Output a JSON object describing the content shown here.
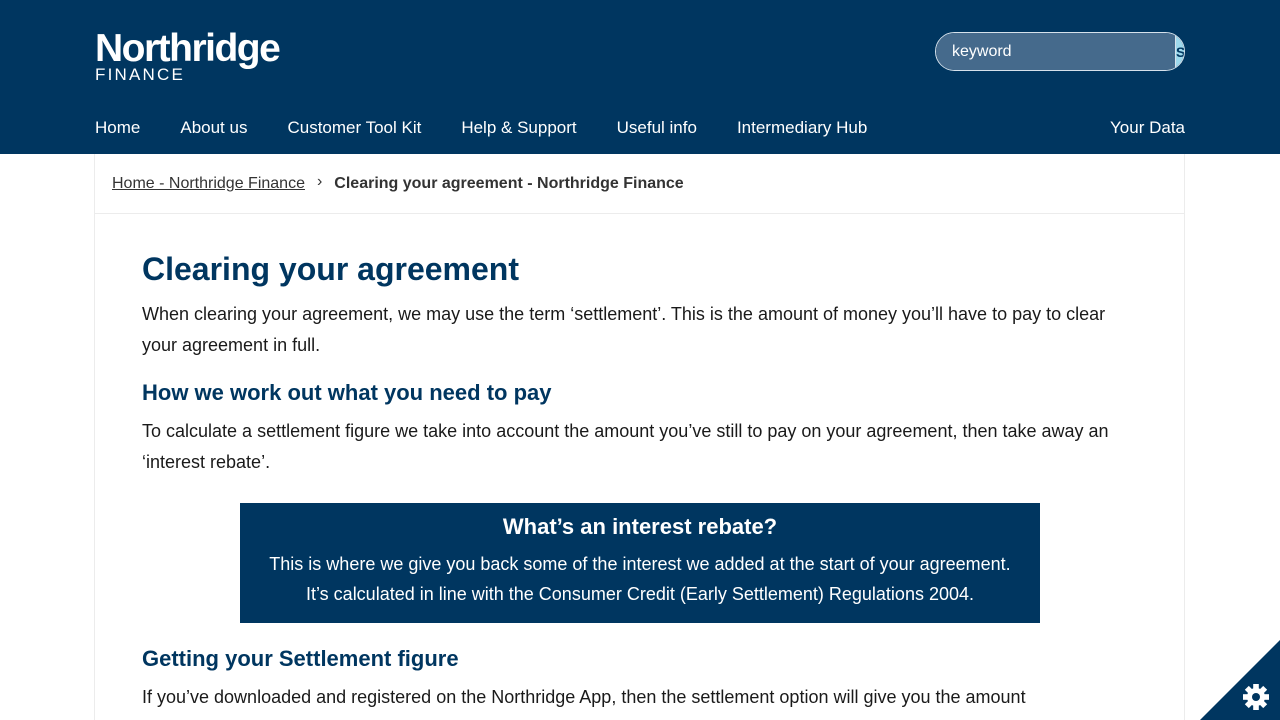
{
  "header": {
    "logo_main": "Northridge",
    "logo_sub": "FINANCE",
    "search": {
      "placeholder": "keyword",
      "button_label": "Search"
    }
  },
  "nav": {
    "items": [
      "Home",
      "About us",
      "Customer Tool Kit",
      "Help & Support",
      "Useful info",
      "Intermediary Hub"
    ],
    "right_item": "Your Data"
  },
  "breadcrumb": {
    "home_link": "Home - Northridge Finance",
    "separator": "›",
    "current": "Clearing your agreement - Northridge Finance"
  },
  "content": {
    "title": "Clearing your agreement",
    "intro": "When clearing your agreement, we may use the term ‘settlement’. This is the amount of money you’ll have to pay to clear your agreement in full.",
    "section1_heading": "How we work out what you need to pay",
    "section1_text": "To calculate a settlement figure we take into account the amount you’ve still to pay on your agreement, then take away an ‘interest rebate’.",
    "callout": {
      "title": "What’s an interest rebate?",
      "line1": "This is where we give you back some of the interest we added at the start of your agreement.",
      "line2": "It’s calculated in line with the Consumer Credit (Early Settlement) Regulations 2004."
    },
    "section2_heading": "Getting your Settlement figure",
    "section2_text": "If you’ve downloaded and registered on the Northridge App, then the settlement option will give you the amount"
  },
  "cookie_button": {
    "icon": "gear-icon"
  },
  "colors": {
    "brand_navy": "#003660",
    "search_button": "#9ed9ec",
    "search_field": "#456a8c"
  }
}
